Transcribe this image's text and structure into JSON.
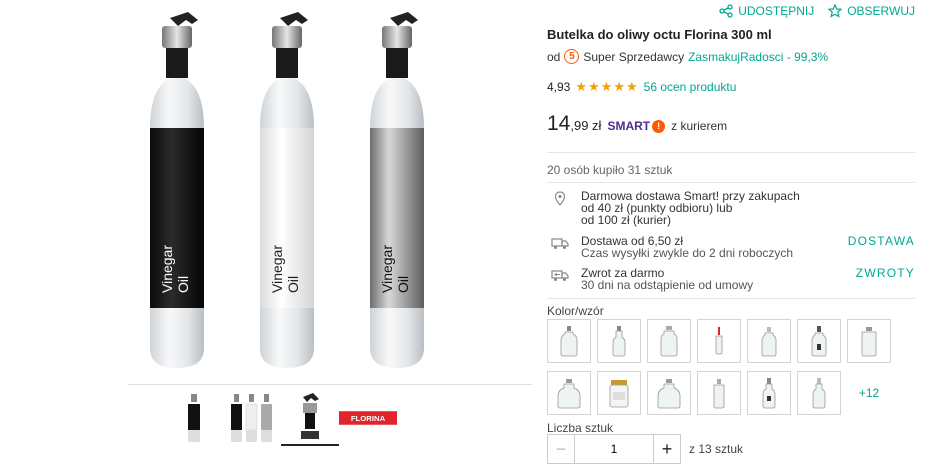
{
  "actions": {
    "share_label": "UDOSTĘPNIJ",
    "share_icon": "share-icon",
    "watch_label": "OBSERWUJ",
    "watch_icon": "star-outline-icon"
  },
  "product": {
    "title": "Butelka do oliwy octu Florina 300 ml",
    "seller_prefix": "od",
    "seller_badge": "5",
    "seller_type": "Super Sprzedawcy",
    "seller_name": "ZasmakujRadosci - 99,3%",
    "rating_value": "4,93",
    "rating_stars": 5,
    "rating_count": "56 ocen produktu",
    "price_int": "14",
    "price_dec": ",99 zł",
    "smart_label": "SMART",
    "smart_bang": "!",
    "courier": "z kurierem",
    "sold": "20 osób kupiło 31 sztuk"
  },
  "bottle_labels": [
    "Vinegar",
    "Oil"
  ],
  "brand_logo": "FLORINA",
  "delivery": [
    {
      "icon": "location-pin-icon",
      "line1": "Darmowa dostawa Smart! przy zakupach",
      "line2": "od 40 zł (punkty odbioru) lub",
      "line3": "od 100 zł (kurier)",
      "link": ""
    },
    {
      "icon": "truck-icon",
      "line1": "Dostawa od 6,50 zł",
      "line2": "Czas wysyłki zwykle do 2 dni roboczych",
      "link": "DOSTAWA"
    },
    {
      "icon": "return-truck-icon",
      "line1": "Zwrot za darmo",
      "line2": "30 dni na odstąpienie od umowy",
      "link": "ZWROTY"
    }
  ],
  "variants_label": "Kolor/wzór",
  "variants_more": "+12",
  "quantity": {
    "label": "Liczba sztuk",
    "value": "1",
    "minus": "−",
    "plus": "+",
    "note": "z 13 sztuk"
  },
  "colors": {
    "accent": "#00a790",
    "star": "#f3a000",
    "smart": "#4f2c90",
    "smart_bang": "#ff5a00",
    "brand_red": "#e0242b"
  }
}
